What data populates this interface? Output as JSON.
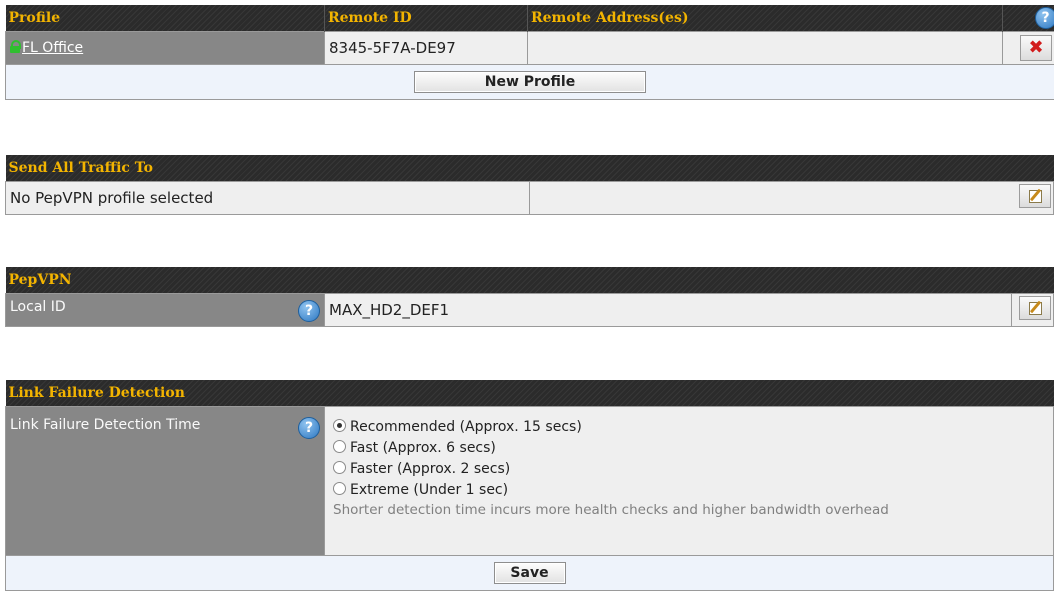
{
  "profiles": {
    "headers": {
      "profile": "Profile",
      "remote_id": "Remote ID",
      "remote_address": "Remote Address(es)"
    },
    "rows": [
      {
        "name": "FL Office",
        "remote_id": "8345-5F7A-DE97",
        "remote_address": ""
      }
    ],
    "new_button": "New Profile"
  },
  "send_all_traffic": {
    "title": "Send All Traffic To",
    "value": "No PepVPN profile selected"
  },
  "pepvpn": {
    "title": "PepVPN",
    "local_id_label": "Local ID",
    "local_id_value": "MAX_HD2_DEF1"
  },
  "link_failure": {
    "title": "Link Failure Detection",
    "label": "Link Failure Detection Time",
    "options": [
      {
        "label": "Recommended (Approx. 15 secs)",
        "selected": true
      },
      {
        "label": "Fast (Approx. 6 secs)",
        "selected": false
      },
      {
        "label": "Faster (Approx. 2 secs)",
        "selected": false
      },
      {
        "label": "Extreme (Under 1 sec)",
        "selected": false
      }
    ],
    "hint": "Shorter detection time incurs more health checks and higher bandwidth overhead",
    "save_button": "Save"
  },
  "help_symbol": "?",
  "delete_symbol": "✖",
  "colors": {
    "header_text": "#f3b400",
    "header_bg": "#2b2b2b",
    "label_bg": "#878787",
    "row_bg": "#efefef",
    "button_row_bg": "#eef3fb",
    "lock_icon": "#2fbf2f",
    "delete_icon": "#d21b1b",
    "help_icon": "#2e78c2"
  },
  "icons": [
    "lock-icon",
    "help-icon",
    "delete-icon",
    "edit-icon",
    "radio-icon"
  ]
}
